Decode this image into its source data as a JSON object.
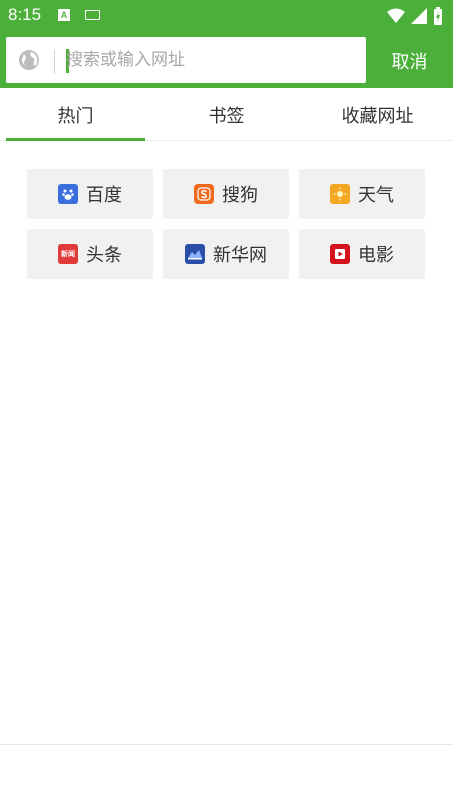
{
  "status": {
    "time": "8:15"
  },
  "search": {
    "placeholder": "搜索或输入网址",
    "value": ""
  },
  "cancel_label": "取消",
  "tabs": [
    {
      "label": "热门",
      "active": true
    },
    {
      "label": "书签",
      "active": false
    },
    {
      "label": "收藏网址",
      "active": false
    }
  ],
  "shortcuts": [
    {
      "label": "百度",
      "icon": "baidu-paw-icon",
      "color": "#3b6fe0"
    },
    {
      "label": "搜狗",
      "icon": "sogou-s-icon",
      "color": "#ee6a1f"
    },
    {
      "label": "天气",
      "icon": "weather-sun-icon",
      "color": "#f4a623"
    },
    {
      "label": "头条",
      "icon": "news-icon",
      "color": "#e03a3a",
      "icon_text": "新闻"
    },
    {
      "label": "新华网",
      "icon": "xinhua-icon",
      "color": "#2a4fa8"
    },
    {
      "label": "电影",
      "icon": "movie-play-icon",
      "color": "#d4141c"
    }
  ],
  "colors": {
    "accent": "#4caf39"
  }
}
